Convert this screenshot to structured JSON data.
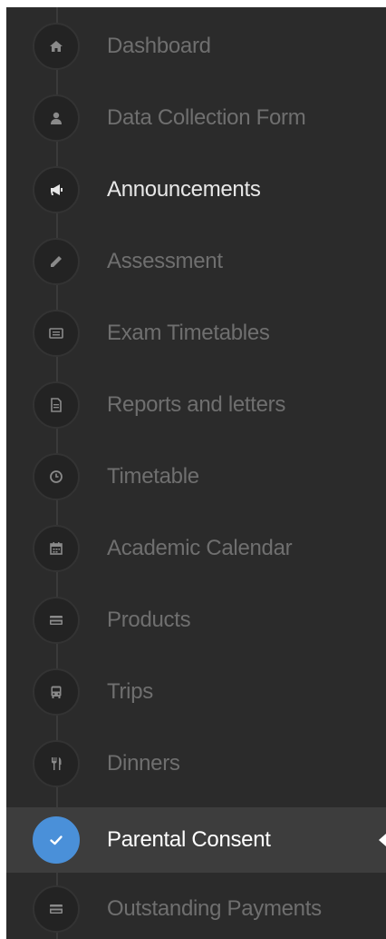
{
  "sidebar": {
    "items": [
      {
        "label": "Dashboard",
        "icon": "home-icon",
        "state": "normal"
      },
      {
        "label": "Data Collection Form",
        "icon": "user-icon",
        "state": "normal"
      },
      {
        "label": "Announcements",
        "icon": "megaphone-icon",
        "state": "highlight"
      },
      {
        "label": "Assessment",
        "icon": "pencil-icon",
        "state": "normal"
      },
      {
        "label": "Exam Timetables",
        "icon": "list-icon",
        "state": "normal"
      },
      {
        "label": "Reports and letters",
        "icon": "document-icon",
        "state": "normal"
      },
      {
        "label": "Timetable",
        "icon": "clock-icon",
        "state": "normal"
      },
      {
        "label": "Academic Calendar",
        "icon": "calendar-icon",
        "state": "normal"
      },
      {
        "label": "Products",
        "icon": "credit-card-icon",
        "state": "normal"
      },
      {
        "label": "Trips",
        "icon": "bus-icon",
        "state": "normal"
      },
      {
        "label": "Dinners",
        "icon": "cutlery-icon",
        "state": "normal"
      },
      {
        "label": "Parental Consent",
        "icon": "check-icon",
        "state": "active"
      },
      {
        "label": "Outstanding Payments",
        "icon": "credit-card-icon",
        "state": "normal"
      }
    ]
  },
  "colors": {
    "sidebar_bg": "#2b2b2b",
    "active_bg": "#3d3d3d",
    "active_accent": "#4a90d9",
    "label_normal": "#6f6f6f",
    "label_active": "#ffffff"
  }
}
